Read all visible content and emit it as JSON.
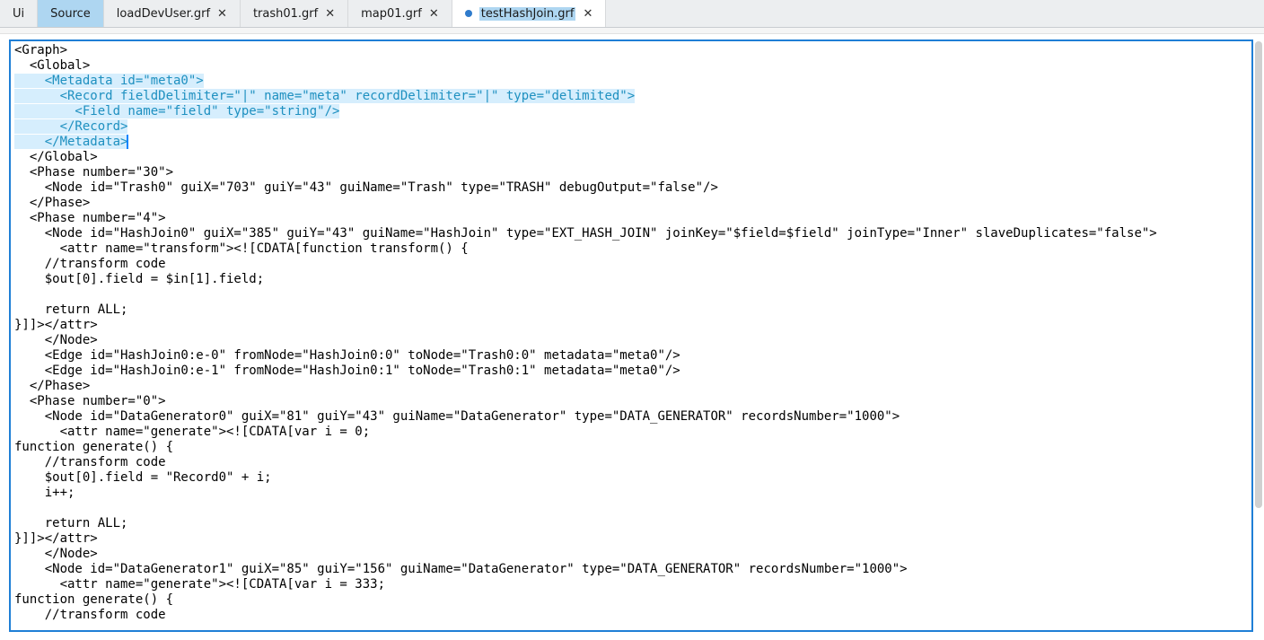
{
  "tabs": {
    "ui": {
      "label": "Ui"
    },
    "source": {
      "label": "Source"
    },
    "load": {
      "label": "loadDevUser.grf"
    },
    "trash": {
      "label": "trash01.grf"
    },
    "map": {
      "label": "map01.grf"
    },
    "hash": {
      "label": "testHashJoin.grf"
    }
  },
  "editor": {
    "selection_lines": [
      "    <Metadata id=\"meta0\">",
      "      <Record fieldDelimiter=\"|\" name=\"meta\" recordDelimiter=\"|\" type=\"delimited\">",
      "        <Field name=\"field\" type=\"string\"/>",
      "      </Record>",
      "    </Metadata>"
    ],
    "pre_lines": [
      "<Graph>",
      "  <Global>"
    ],
    "post_lines": [
      "  </Global>",
      "  <Phase number=\"30\">",
      "    <Node id=\"Trash0\" guiX=\"703\" guiY=\"43\" guiName=\"Trash\" type=\"TRASH\" debugOutput=\"false\"/>",
      "  </Phase>",
      "  <Phase number=\"4\">",
      "    <Node id=\"HashJoin0\" guiX=\"385\" guiY=\"43\" guiName=\"HashJoin\" type=\"EXT_HASH_JOIN\" joinKey=\"$field=$field\" joinType=\"Inner\" slaveDuplicates=\"false\">",
      "      <attr name=\"transform\"><![CDATA[function transform() {",
      "    //transform code",
      "    $out[0].field = $in[1].field;",
      "",
      "    return ALL;",
      "}]]></attr>",
      "    </Node>",
      "    <Edge id=\"HashJoin0:e-0\" fromNode=\"HashJoin0:0\" toNode=\"Trash0:0\" metadata=\"meta0\"/>",
      "    <Edge id=\"HashJoin0:e-1\" fromNode=\"HashJoin0:1\" toNode=\"Trash0:1\" metadata=\"meta0\"/>",
      "  </Phase>",
      "  <Phase number=\"0\">",
      "    <Node id=\"DataGenerator0\" guiX=\"81\" guiY=\"43\" guiName=\"DataGenerator\" type=\"DATA_GENERATOR\" recordsNumber=\"1000\">",
      "      <attr name=\"generate\"><![CDATA[var i = 0;",
      "function generate() {",
      "    //transform code",
      "    $out[0].field = \"Record0\" + i;",
      "    i++;",
      "",
      "    return ALL;",
      "}]]></attr>",
      "    </Node>",
      "    <Node id=\"DataGenerator1\" guiX=\"85\" guiY=\"156\" guiName=\"DataGenerator\" type=\"DATA_GENERATOR\" recordsNumber=\"1000\">",
      "      <attr name=\"generate\"><![CDATA[var i = 333;",
      "function generate() {",
      "    //transform code"
    ]
  }
}
